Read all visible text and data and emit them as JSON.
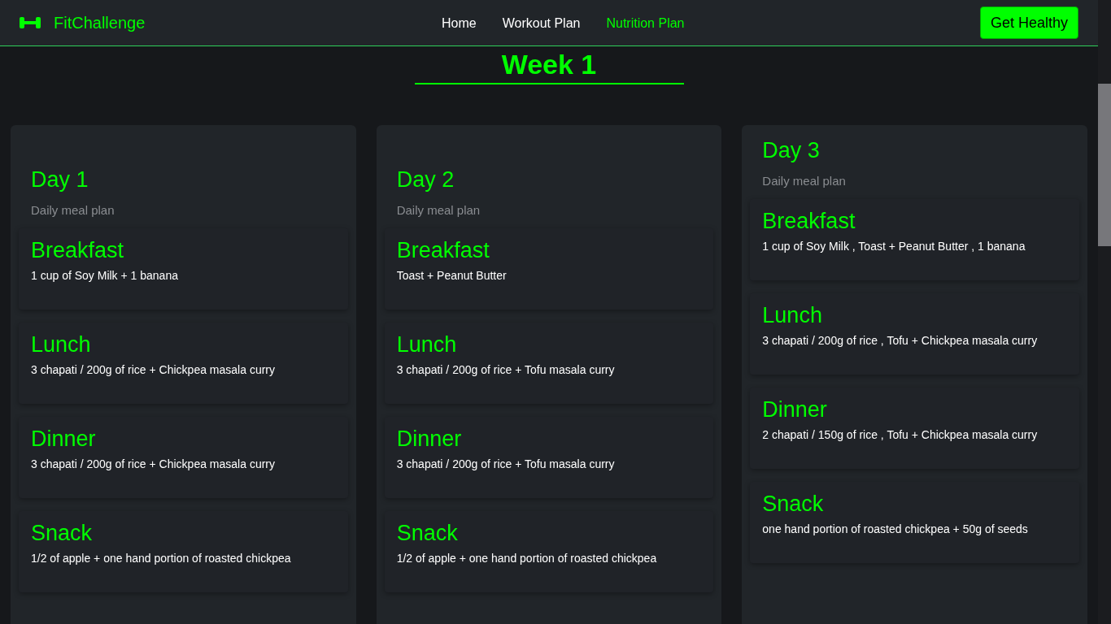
{
  "navbar": {
    "brand": "FitChallenge",
    "links": [
      {
        "label": "Home",
        "selected": false
      },
      {
        "label": "Workout Plan",
        "selected": false
      },
      {
        "label": "Nutrition Plan",
        "selected": true
      }
    ],
    "cta": "Get Healthy"
  },
  "section_title": "Week 1",
  "days": [
    {
      "title": "Day 1",
      "subtitle": "Daily meal plan",
      "meals": [
        {
          "name": "Breakfast",
          "text": "1 cup of Soy Milk + 1 banana"
        },
        {
          "name": "Lunch",
          "text": "3 chapati / 200g of rice + Chickpea masala curry"
        },
        {
          "name": "Dinner",
          "text": "3 chapati / 200g of rice + Chickpea masala curry"
        },
        {
          "name": "Snack",
          "text": "1/2 of apple + one hand portion of roasted chickpea"
        }
      ]
    },
    {
      "title": "Day 2",
      "subtitle": "Daily meal plan",
      "meals": [
        {
          "name": "Breakfast",
          "text": "Toast + Peanut Butter"
        },
        {
          "name": "Lunch",
          "text": "3 chapati / 200g of rice + Tofu masala curry"
        },
        {
          "name": "Dinner",
          "text": "3 chapati / 200g of rice + Tofu masala curry"
        },
        {
          "name": "Snack",
          "text": "1/2 of apple + one hand portion of roasted chickpea"
        }
      ]
    },
    {
      "title": "Day 3",
      "subtitle": "Daily meal plan",
      "meals": [
        {
          "name": "Breakfast",
          "text": "1 cup of Soy Milk , Toast + Peanut Butter , 1 banana"
        },
        {
          "name": "Lunch",
          "text": "3 chapati / 200g of rice , Tofu + Chickpea masala curry"
        },
        {
          "name": "Dinner",
          "text": "2 chapati / 150g of rice , Tofu + Chickpea masala curry"
        },
        {
          "name": "Snack",
          "text": "one hand portion of roasted chickpea + 50g of seeds"
        }
      ]
    }
  ]
}
